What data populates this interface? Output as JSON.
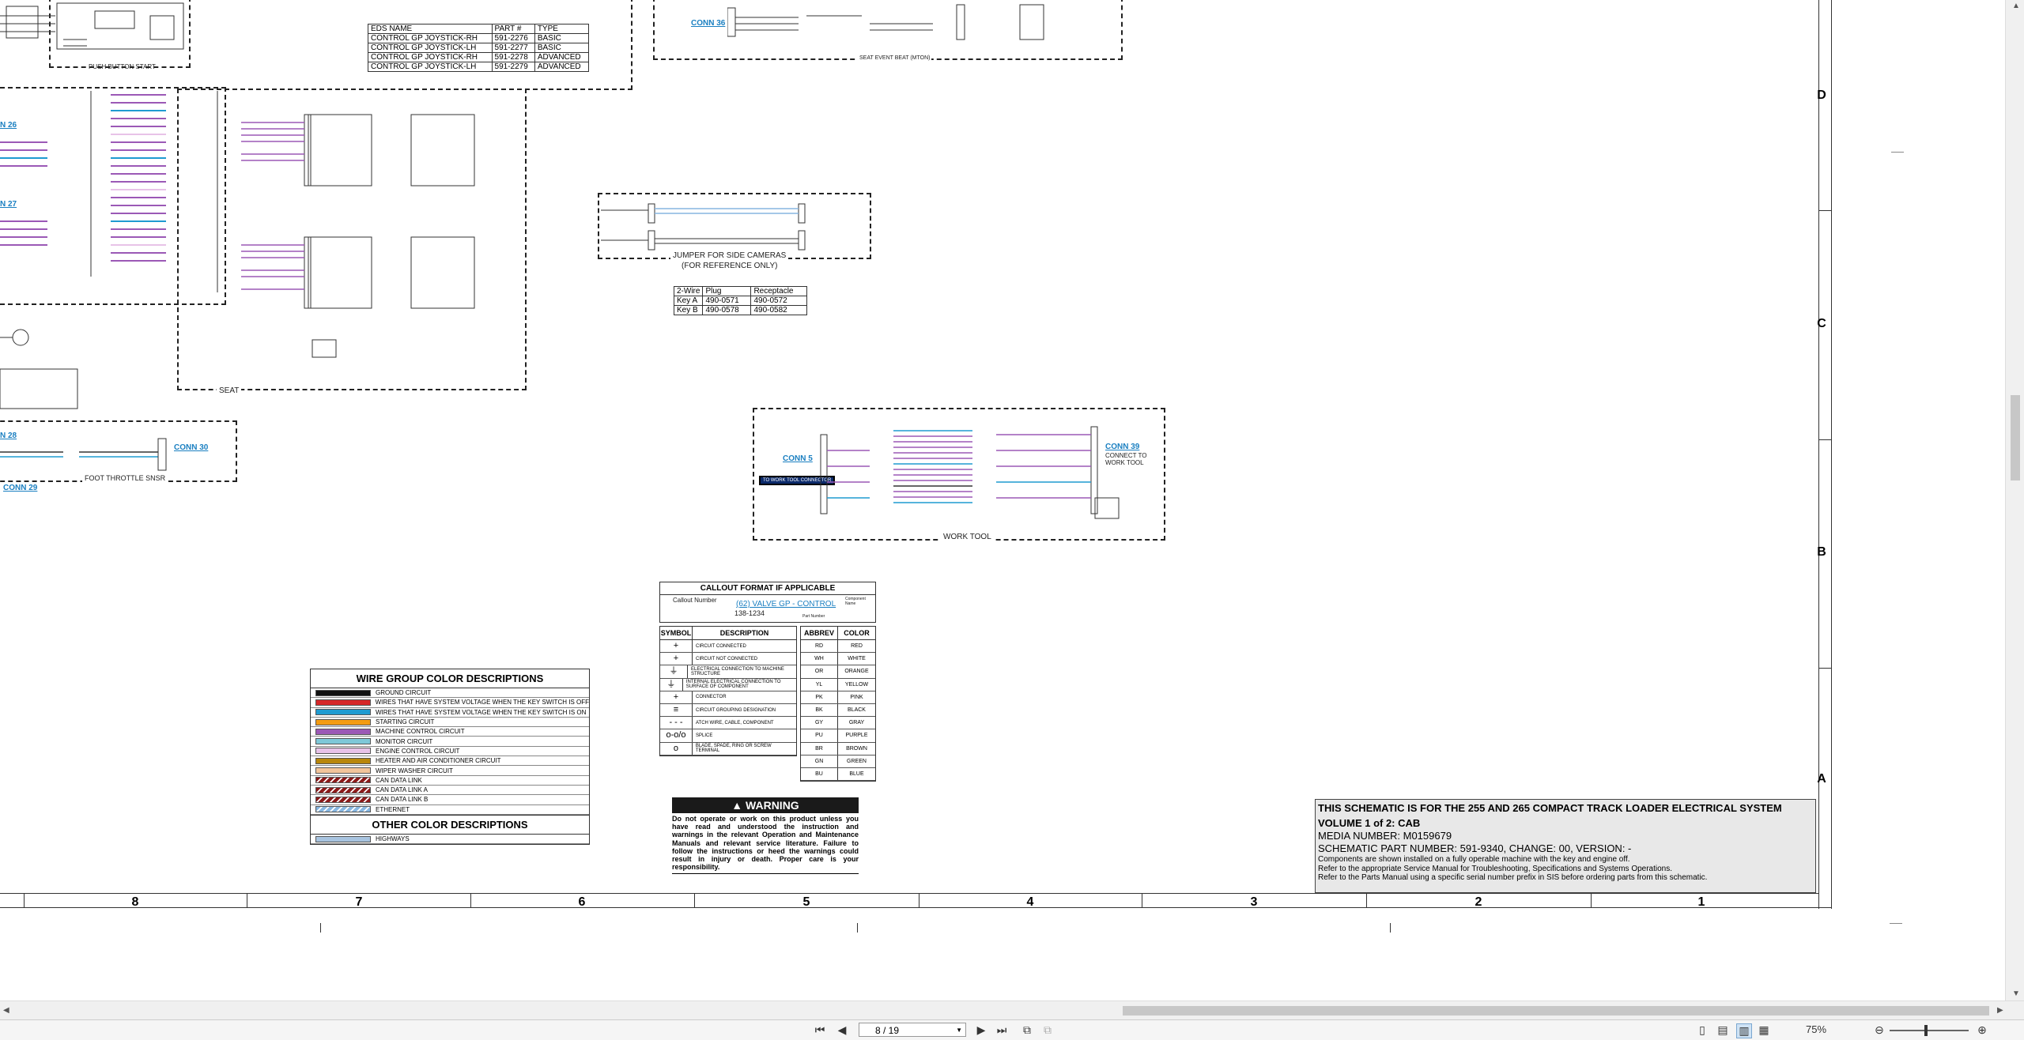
{
  "document": {
    "eds_table": {
      "headers": [
        "EDS NAME",
        "PART #",
        "TYPE"
      ],
      "rows": [
        [
          "CONTROL GP JOYSTICK-RH",
          "591-2276",
          "BASIC"
        ],
        [
          "CONTROL GP JOYSTICK-LH",
          "591-2277",
          "BASIC"
        ],
        [
          "CONTROL GP JOYSTICK-RH",
          "591-2278",
          "ADVANCED"
        ],
        [
          "CONTROL GP JOYSTICK-LH",
          "591-2279",
          "ADVANCED"
        ]
      ]
    },
    "push_button_start": "PUSH BUTTON START",
    "seat_label": "SEAT",
    "foot_throttle_label": "FOOT THROTTLE SNSR",
    "conn_26": "N 26",
    "conn_27": "N 27",
    "conn_28": "N 28",
    "conn_29": "CONN 29",
    "conn_30": "CONN 30",
    "conn_36": "CONN 36",
    "conn_5": "CONN 5",
    "conn_39": "CONN 39",
    "conn_39_sub": "CONNECT TO WORK TOOL",
    "seat_event_beat": "SEAT EVENT BEAT (MTON)",
    "jumper_label": "JUMPER FOR SIDE CAMERAS",
    "jumper_sub": "(FOR REFERENCE ONLY)",
    "key_table": {
      "headers": [
        "2-Wire",
        "Plug",
        "Receptacle"
      ],
      "rows": [
        [
          "Key A",
          "490-0571",
          "490-0572"
        ],
        [
          "Key B",
          "490-0578",
          "490-0582"
        ]
      ]
    },
    "work_tool_label": "WORK TOOL",
    "work_tool_tag": "TO WORK TOOL CONNECTOR",
    "wire_group": {
      "title": "WIRE GROUP COLOR DESCRIPTIONS",
      "rows": [
        {
          "desc": "GROUND CIRCUIT",
          "color": "#111111"
        },
        {
          "desc": "WIRES THAT HAVE SYSTEM VOLTAGE WHEN THE KEY SWITCH IS OFF",
          "color": "#d62728"
        },
        {
          "desc": "WIRES THAT HAVE SYSTEM VOLTAGE WHEN THE KEY SWITCH IS ON",
          "color": "#1f9bd1"
        },
        {
          "desc": "STARTING CIRCUIT",
          "color": "#f39c12"
        },
        {
          "desc": "MACHINE CONTROL CIRCUIT",
          "color": "#9b59b6"
        },
        {
          "desc": "MONITOR CIRCUIT",
          "color": "#7ec8d8"
        },
        {
          "desc": "ENGINE CONTROL CIRCUIT",
          "color": "#e8c3e8"
        },
        {
          "desc": "HEATER AND AIR CONDITIONER CIRCUIT",
          "color": "#b8860b"
        },
        {
          "desc": "WIPER WASHER CIRCUIT",
          "color": "#f2c49b"
        },
        {
          "desc": "CAN DATA LINK",
          "color": "#8b1a1a"
        },
        {
          "desc": "CAN DATA LINK A",
          "color": "#8b1a1a"
        },
        {
          "desc": "CAN DATA LINK B",
          "color": "#8b1a1a"
        },
        {
          "desc": "ETHERNET",
          "color": "#87b6e0"
        }
      ],
      "other_title": "OTHER COLOR DESCRIPTIONS",
      "other_rows": [
        {
          "desc": "HIGHWAYS",
          "color": "#a8c4e0"
        }
      ]
    },
    "callout": {
      "title": "CALLOUT FORMAT IF APPLICABLE",
      "callout_number": "Callout Number",
      "example_link": "(62) VALVE GP - CONTROL",
      "part_number": "138-1234",
      "component_name": "Component Name",
      "part_label": "Part Number"
    },
    "symbol_table": {
      "headers": [
        "SYMBOL",
        "DESCRIPTION"
      ],
      "rows": [
        {
          "symbol": "+",
          "desc": "CIRCUIT CONNECTED"
        },
        {
          "symbol": "+",
          "desc": "CIRCUIT NOT CONNECTED"
        },
        {
          "symbol": "⏚",
          "desc": "ELECTRICAL CONNECTION TO MACHINE STRUCTURE"
        },
        {
          "symbol": "⏚",
          "desc": "INTERNAL ELECTRICAL CONNECTION TO SURFACE OF COMPONENT"
        },
        {
          "symbol": "+",
          "desc": "CONNECTOR"
        },
        {
          "symbol": "≡",
          "desc": "CIRCUIT GROUPING DESIGNATION"
        },
        {
          "symbol": "- - -",
          "desc": "ATCH WIRE, CABLE, COMPONENT"
        },
        {
          "symbol": "o-o/o",
          "desc": "SPLICE"
        },
        {
          "symbol": "o",
          "desc": "BLADE, SPADE, RING OR SCREW TERMINAL"
        }
      ]
    },
    "abbrev_table": {
      "headers": [
        "ABBREV",
        "COLOR"
      ],
      "rows": [
        [
          "RD",
          "RED"
        ],
        [
          "WH",
          "WHITE"
        ],
        [
          "OR",
          "ORANGE"
        ],
        [
          "YL",
          "YELLOW"
        ],
        [
          "PK",
          "PINK"
        ],
        [
          "BK",
          "BLACK"
        ],
        [
          "GY",
          "GRAY"
        ],
        [
          "PU",
          "PURPLE"
        ],
        [
          "BR",
          "BROWN"
        ],
        [
          "GN",
          "GREEN"
        ],
        [
          "BU",
          "BLUE"
        ]
      ]
    },
    "warning": {
      "title": "WARNING",
      "text": "Do not operate or work on this product unless you have read and understood the instruction and warnings in the relevant Operation and Maintenance Manuals and relevant service literature. Failure to follow the instructions or heed the warnings could result in injury or death. Proper care is your responsibility."
    },
    "title_block": {
      "line1": "THIS SCHEMATIC IS FOR THE 255 AND 265 COMPACT TRACK LOADER ELECTRICAL SYSTEM",
      "line2": "VOLUME 1 of 2: CAB",
      "line3": "MEDIA NUMBER: M0159679",
      "line4": "SCHEMATIC PART NUMBER: 591-9340, CHANGE: 00, VERSION: -",
      "line5": "Components are shown installed on a fully operable machine with the key and engine off.",
      "line6": "Refer to the appropriate Service Manual for Troubleshooting, Specifications and Systems Operations.",
      "line7": "Refer to the Parts Manual using a specific serial number prefix in SIS before ordering parts from this schematic."
    },
    "row_letters": [
      "D",
      "C",
      "B",
      "A"
    ],
    "column_numbers": [
      "8",
      "7",
      "6",
      "5",
      "4",
      "3",
      "2",
      "1"
    ]
  },
  "viewer": {
    "page_field": "8 / 19",
    "zoom": "75%"
  }
}
